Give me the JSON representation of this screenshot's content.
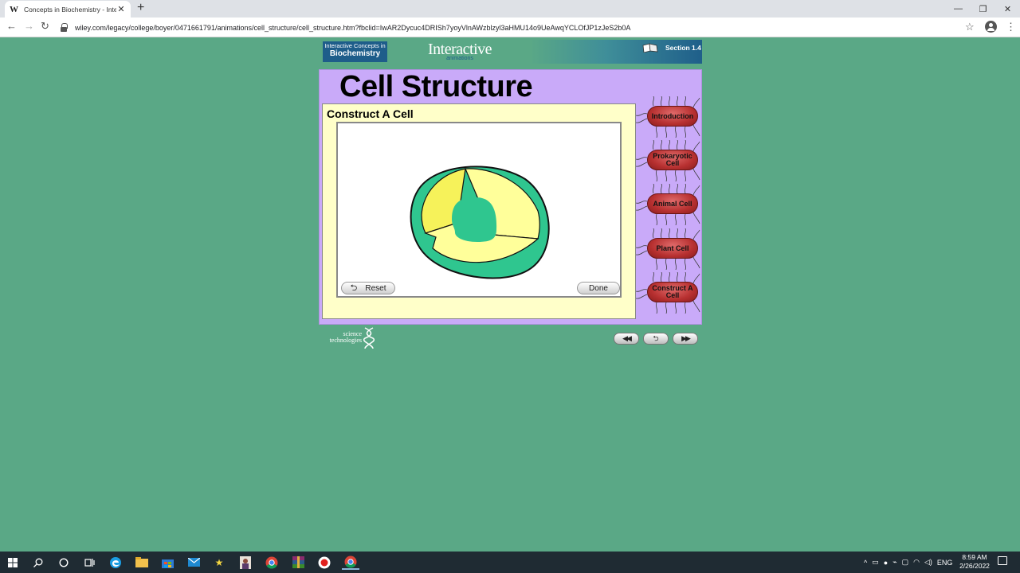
{
  "browser": {
    "tab": {
      "favicon": "W",
      "title": "Concepts in Biochemistry - Intera",
      "close": "✕"
    },
    "new_tab": "+",
    "url": "wiley.com/legacy/college/boyer/0471661791/animations/cell_structure/cell_structure.htm?fbclid=IwAR2Dycuc4DRISh7yoyVlnAWzblzyl3aHMU14o9UeAwqYCLOfJP1zJeS2b0A",
    "window_controls": [
      "—",
      "❐",
      "✕"
    ],
    "nav": {
      "back": "←",
      "forward": "→",
      "reload": "↻",
      "star": "☆",
      "menu": "⋮"
    }
  },
  "banner": {
    "badge_line1": "Interactive Concepts in",
    "badge_line2": "Biochemistry",
    "interactive": "Interactive",
    "animations": "animations",
    "section": "Section 1.4"
  },
  "panel": {
    "title": "Cell Structure",
    "heading": "Construct  A Cell",
    "reset_label": "Reset",
    "done_label": "Done"
  },
  "menu": [
    {
      "label": "Introduction"
    },
    {
      "label": "Prokaryotic Cell"
    },
    {
      "label": "Animal Cell"
    },
    {
      "label": "Plant Cell"
    },
    {
      "label": "Construct A Cell"
    }
  ],
  "footer": {
    "logo_line1": "science",
    "logo_line2": "technologies",
    "rewind": "◀◀",
    "back": "⮌",
    "forward": "▶▶"
  },
  "cell_colors": {
    "outer": "#2fc68f",
    "cytoplasm": "#ffff9a",
    "cytoplasm_shade": "#f6f25a",
    "nucleus": "#2fc68f"
  },
  "taskbar": {
    "clock_time": "8:59 AM",
    "clock_date": "2/26/2022",
    "language": "ENG",
    "tray_chevron": "^"
  }
}
